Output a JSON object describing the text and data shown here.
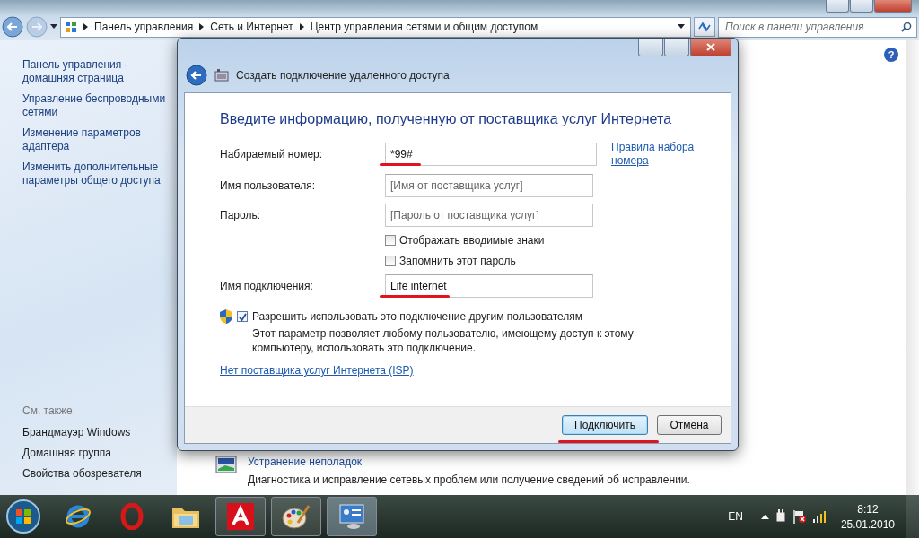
{
  "explorer": {
    "breadcrumb": [
      "Панель управления",
      "Сеть и Интернет",
      "Центр управления сетями и общим доступом"
    ],
    "search": {
      "placeholder": "Поиск в панели управления"
    }
  },
  "sidebar": {
    "links": [
      "Панель управления - домашняя страница",
      "Управление беспроводными сетями",
      "Изменение параметров адаптера",
      "Изменить дополнительные параметры общего доступа"
    ],
    "see_also_title": "См. также",
    "see_also": [
      "Брандмауэр Windows",
      "Домашняя группа",
      "Свойства обозревателя"
    ]
  },
  "content": {
    "help": "?",
    "troubleshoot": {
      "title": "Устранение неполадок",
      "description": "Диагностика и исправление сетевых проблем или получение сведений об исправлении."
    }
  },
  "dialog": {
    "title": "Создать подключение удаленного доступа",
    "heading": "Введите информацию, полученную от поставщика услуг Интернета",
    "fields": [
      {
        "label": "Набираемый номер:",
        "value": "*99#",
        "highlighted": true
      },
      {
        "label": "Имя пользователя:",
        "placeholder": "[Имя от поставщика услуг]",
        "highlighted": false
      },
      {
        "label": "Пароль:",
        "placeholder": "[Пароль от поставщика услуг]",
        "highlighted": false
      }
    ],
    "dial_rules_link": "Правила набора номера",
    "checkboxes": [
      {
        "label": "Отображать вводимые знаки",
        "checked": false
      },
      {
        "label": "Запомнить этот пароль",
        "checked": false
      }
    ],
    "connection_name": {
      "label": "Имя подключения:",
      "value": "Life internet",
      "highlighted": true
    },
    "allow_others": {
      "label": "Разрешить использовать это подключение другим пользователям",
      "checked": true,
      "description": "Этот параметр позволяет любому пользователю, имеющему доступ к этому компьютеру, использовать это подключение."
    },
    "no_isp_link": "Нет поставщика услуг Интернета (ISP)",
    "buttons": [
      {
        "label": "Подключить",
        "default": true,
        "highlighted": true
      },
      {
        "label": "Отмена",
        "default": false,
        "highlighted": false
      }
    ]
  },
  "taskbar": {
    "language": "EN",
    "time": "8:12",
    "date": "25.01.2010"
  }
}
